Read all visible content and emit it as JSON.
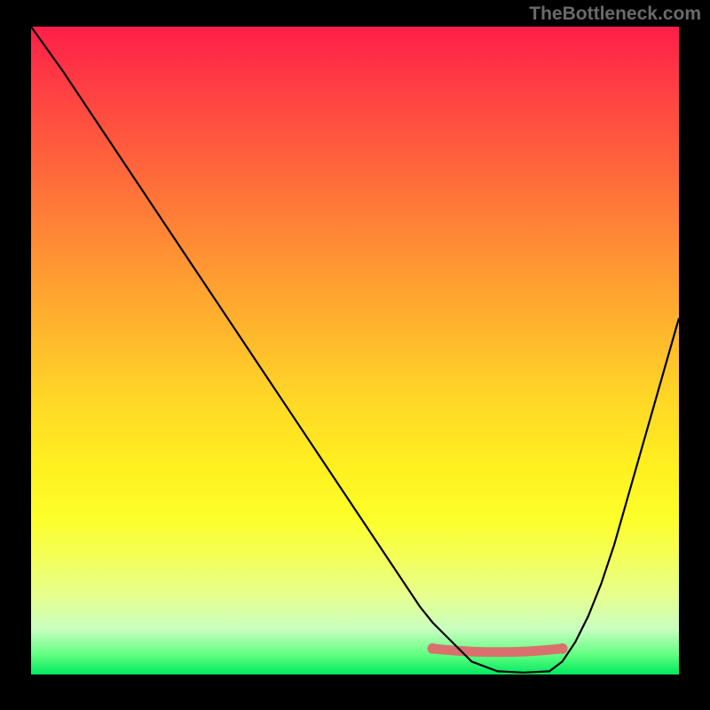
{
  "watermark": "TheBottleneck.com",
  "chart_data": {
    "type": "line",
    "title": "",
    "xlabel": "",
    "ylabel": "",
    "xlim": [
      0,
      100
    ],
    "ylim": [
      0,
      100
    ],
    "note": "No axis tick labels are shown; x and values are in percent of plot area. Higher value = higher (red) region. Minimum band near x≈68–82.",
    "series": [
      {
        "name": "curve",
        "x": [
          0,
          5,
          10,
          15,
          20,
          25,
          30,
          35,
          40,
          45,
          50,
          55,
          60,
          62,
          65,
          68,
          72,
          76,
          80,
          82,
          84,
          86,
          88,
          90,
          92,
          94,
          96,
          98,
          100
        ],
        "values": [
          100,
          93,
          85.5,
          78,
          70.5,
          63,
          55.5,
          48,
          40.5,
          33,
          25.5,
          18,
          10.5,
          8,
          5,
          2,
          0.5,
          0.3,
          0.5,
          2,
          5,
          9,
          14,
          20,
          27,
          34,
          41,
          48,
          55
        ]
      },
      {
        "name": "highlight-band",
        "type": "segment",
        "x": [
          62,
          82
        ],
        "values": [
          4,
          4
        ]
      }
    ],
    "colors": {
      "curve": "#000000",
      "highlight": "#d9706e",
      "gradient_top": "#ff1e49",
      "gradient_bottom": "#00e860"
    }
  }
}
